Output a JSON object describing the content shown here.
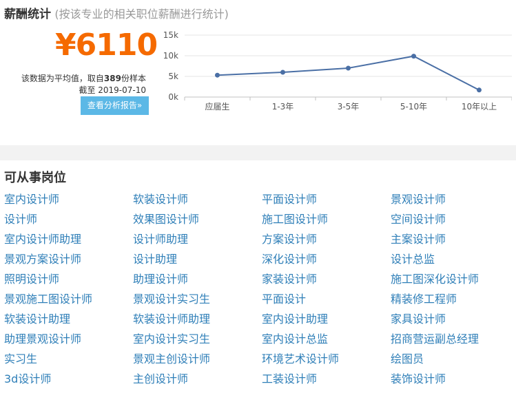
{
  "salary": {
    "title": "薪酬统计",
    "subtitle": "(按该专业的相关职位薪酬进行统计)",
    "amount": "¥6110",
    "note_prefix": "该数据为平均值，取自",
    "sample_count": "389",
    "note_suffix": "份样本",
    "date_line": "截至 2019-07-10",
    "report_button": "查看分析报告»"
  },
  "chart_data": {
    "type": "line",
    "categories": [
      "应届生",
      "1-3年",
      "3-5年",
      "5-10年",
      "10年以上"
    ],
    "series": [
      {
        "values": [
          5300,
          6000,
          7000,
          9900,
          1700
        ]
      }
    ],
    "yticks": [
      "15k",
      "10k",
      "5k",
      "0k"
    ],
    "ylim": [
      0,
      15000
    ],
    "line_color": "#4a6fa5"
  },
  "jobs": {
    "title": "可从事岗位",
    "items": [
      "室内设计师",
      "软装设计师",
      "平面设计师",
      "景观设计师",
      "设计师",
      "效果图设计师",
      "施工图设计师",
      "空间设计师",
      "室内设计师助理",
      "设计师助理",
      "方案设计师",
      "主案设计师",
      "景观方案设计师",
      "设计助理",
      "深化设计师",
      "设计总监",
      "照明设计师",
      "助理设计师",
      "家装设计师",
      "施工图深化设计师",
      "景观施工图设计师",
      "景观设计实习生",
      "平面设计",
      "精装修工程师",
      "软装设计助理",
      "软装设计师助理",
      "室内设计助理",
      "家具设计师",
      "助理景观设计师",
      "室内设计实习生",
      "室内设计总监",
      "招商营运副总经理",
      "实习生",
      "景观主创设计师",
      "环境艺术设计师",
      "绘图员",
      "3d设计师",
      "主创设计师",
      "工装设计师",
      "装饰设计师"
    ]
  }
}
